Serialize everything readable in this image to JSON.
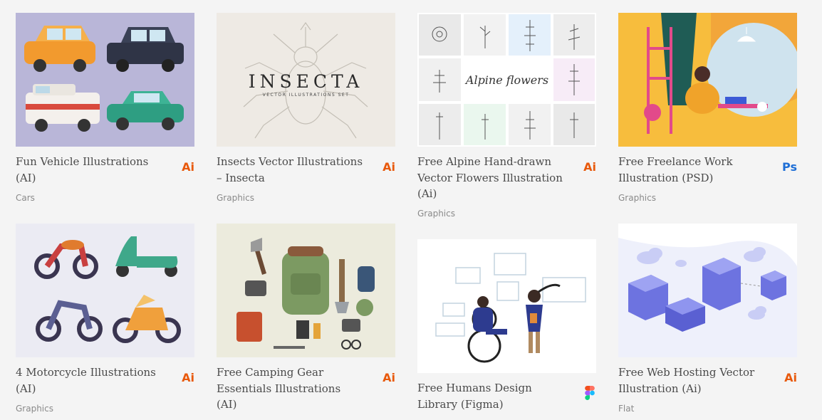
{
  "cards": [
    {
      "title_l1": "Fun Vehicle Illustrations",
      "title_l2": "(AI)",
      "title_l3": "",
      "badge": "Ai",
      "category": "Cars"
    },
    {
      "title_l1": "Insects Vector Illustrations",
      "title_l2": "– Insecta",
      "title_l3": "",
      "badge": "Ai",
      "category": "Graphics"
    },
    {
      "title_l1": "Free Alpine Hand-drawn",
      "title_l2": "Vector Flowers Illustration",
      "title_l3": "(Ai)",
      "badge": "Ai",
      "category": "Graphics"
    },
    {
      "title_l1": "Free Freelance Work",
      "title_l2": "Illustration (PSD)",
      "title_l3": "",
      "badge": "Ps",
      "category": "Graphics"
    },
    {
      "title_l1": "4 Motorcycle Illustrations",
      "title_l2": "(AI)",
      "title_l3": "",
      "badge": "Ai",
      "category": "Graphics"
    },
    {
      "title_l1": "Free Camping Gear",
      "title_l2": "Essentials Illustrations",
      "title_l3": "(AI)",
      "badge": "Ai",
      "category": ""
    },
    {
      "title_l1": "Free Humans Design",
      "title_l2": "Library (Figma)",
      "title_l3": "",
      "badge": "",
      "category": ""
    },
    {
      "title_l1": "Free Web Hosting Vector",
      "title_l2": "Illustration (Ai)",
      "title_l3": "",
      "badge": "Ai",
      "category": "Flat"
    }
  ],
  "thumb_text": {
    "insecta_title": "INSECTA",
    "insecta_sub": "VECTOR ILLUSTRATIONS SET",
    "alpine_script": "Alpine flowers"
  },
  "colors": {
    "ai_badge": "#e8590c",
    "ps_badge": "#1f6fd6"
  }
}
